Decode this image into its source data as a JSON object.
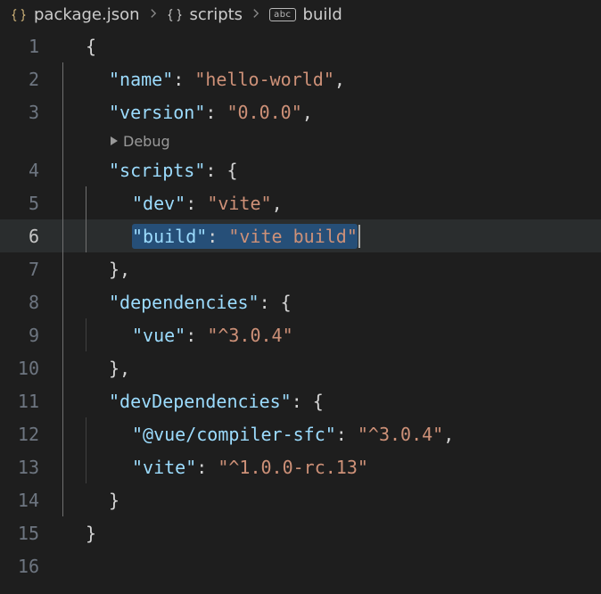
{
  "breadcrumb": {
    "file": "package.json",
    "path1": "scripts",
    "path2": "build"
  },
  "codelens": {
    "debug": "Debug"
  },
  "gutter": {
    "l1": "1",
    "l2": "2",
    "l3": "3",
    "l4": "4",
    "l5": "5",
    "l6": "6",
    "l7": "7",
    "l8": "8",
    "l9": "9",
    "l10": "10",
    "l11": "11",
    "l12": "12",
    "l13": "13",
    "l14": "14",
    "l15": "15",
    "l16": "16"
  },
  "tok": {
    "lbrace": "{",
    "rbrace": "}",
    "comma": ",",
    "colon": ": ",
    "qname": "\"name\"",
    "vname": "\"hello-world\"",
    "qversion": "\"version\"",
    "vversion": "\"0.0.0\"",
    "qscripts": "\"scripts\"",
    "qdev": "\"dev\"",
    "vdev": "\"vite\"",
    "qbuild": "\"build\"",
    "vbuild": "\"vite build\"",
    "qdeps": "\"dependencies\"",
    "qvue": "\"vue\"",
    "vvue": "\"^3.0.4\"",
    "qdevdeps": "\"devDependencies\"",
    "qcompiler": "\"@vue/compiler-sfc\"",
    "vcompiler": "\"^3.0.4\"",
    "qvite": "\"vite\"",
    "vvite": "\"^1.0.0-rc.13\""
  }
}
